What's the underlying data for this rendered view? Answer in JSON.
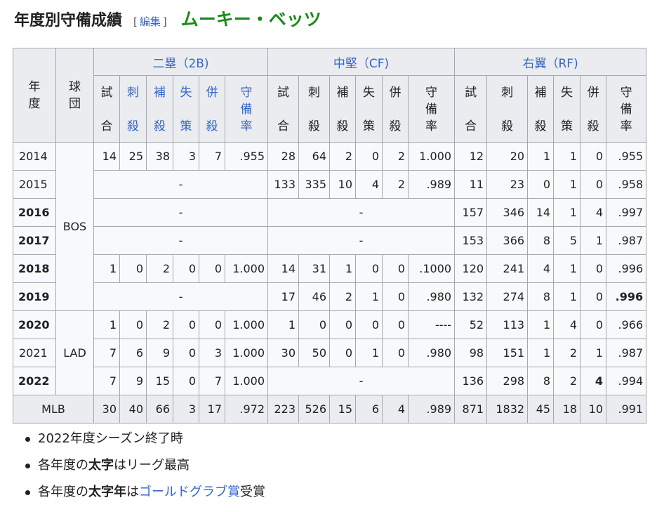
{
  "header": {
    "title": "年度別守備成績",
    "edit_open": "[",
    "edit_label": "編集",
    "edit_close": "]",
    "player": "ムーキー・ベッツ"
  },
  "table": {
    "col_year": "年度",
    "col_team": "球団",
    "positions": [
      "二塁（2B)",
      "中堅（CF)",
      "右翼（RF)"
    ],
    "stat_headers": [
      [
        "試",
        "合"
      ],
      [
        "刺",
        "殺"
      ],
      [
        "補",
        "殺"
      ],
      [
        "失",
        "策"
      ],
      [
        "併",
        "殺"
      ],
      [
        "守",
        "備",
        "率"
      ]
    ],
    "rows": [
      {
        "year": "2014",
        "team": "BOS"
      },
      {
        "year": "2015"
      },
      {
        "year": "2016"
      },
      {
        "year": "2017"
      },
      {
        "year": "2018"
      },
      {
        "year": "2019"
      },
      {
        "year": "2020",
        "team": "LAD"
      },
      {
        "year": "2021"
      },
      {
        "year": "2022"
      }
    ],
    "dash": "-",
    "cells": {
      "r2014": {
        "b2": [
          "14",
          "25",
          "38",
          "3",
          "7",
          ".955"
        ],
        "cf": [
          "28",
          "64",
          "2",
          "0",
          "2",
          "1.000"
        ],
        "rf": [
          "12",
          "20",
          "1",
          "1",
          "0",
          ".955"
        ]
      },
      "r2015": {
        "cf": [
          "133",
          "335",
          "10",
          "4",
          "2",
          ".989"
        ],
        "rf": [
          "11",
          "23",
          "0",
          "1",
          "0",
          ".958"
        ]
      },
      "r2016": {
        "rf": [
          "157",
          "346",
          "14",
          "1",
          "4",
          ".997"
        ]
      },
      "r2017": {
        "rf": [
          "153",
          "366",
          "8",
          "5",
          "1",
          ".987"
        ]
      },
      "r2018": {
        "b2": [
          "1",
          "0",
          "2",
          "0",
          "0",
          "1.000"
        ],
        "cf": [
          "14",
          "31",
          "1",
          "0",
          "0",
          ".1000"
        ],
        "rf": [
          "120",
          "241",
          "4",
          "1",
          "0",
          ".996"
        ]
      },
      "r2019": {
        "cf": [
          "17",
          "46",
          "2",
          "1",
          "0",
          ".980"
        ],
        "rf": [
          "132",
          "274",
          "8",
          "1",
          "0",
          ".996"
        ]
      },
      "r2020": {
        "b2": [
          "1",
          "0",
          "2",
          "0",
          "0",
          "1.000"
        ],
        "cf": [
          "1",
          "0",
          "0",
          "0",
          "0",
          "----"
        ],
        "rf": [
          "52",
          "113",
          "1",
          "4",
          "0",
          ".966"
        ]
      },
      "r2021": {
        "b2": [
          "7",
          "6",
          "9",
          "0",
          "3",
          "1.000"
        ],
        "cf": [
          "30",
          "50",
          "0",
          "1",
          "0",
          ".980"
        ],
        "rf": [
          "98",
          "151",
          "1",
          "2",
          "1",
          ".987"
        ]
      },
      "r2022": {
        "b2": [
          "7",
          "9",
          "15",
          "0",
          "7",
          "1.000"
        ],
        "rf": [
          "136",
          "298",
          "8",
          "2",
          "4",
          ".994"
        ]
      }
    },
    "total": {
      "label": "MLB",
      "values": [
        "30",
        "40",
        "66",
        "3",
        "17",
        ".972",
        "223",
        "526",
        "15",
        "6",
        "4",
        ".989",
        "871",
        "1832",
        "45",
        "18",
        "10",
        ".991"
      ]
    }
  },
  "notes": {
    "n1": "2022年度シーズン終了時",
    "n2_a": "各年度の",
    "n2_b": "太字",
    "n2_c": "はリーグ最高",
    "n3_a": "各年度の",
    "n3_b": "太字年",
    "n3_c": "は",
    "n3_link": "ゴールドグラブ賞",
    "n3_d": "受賞"
  }
}
